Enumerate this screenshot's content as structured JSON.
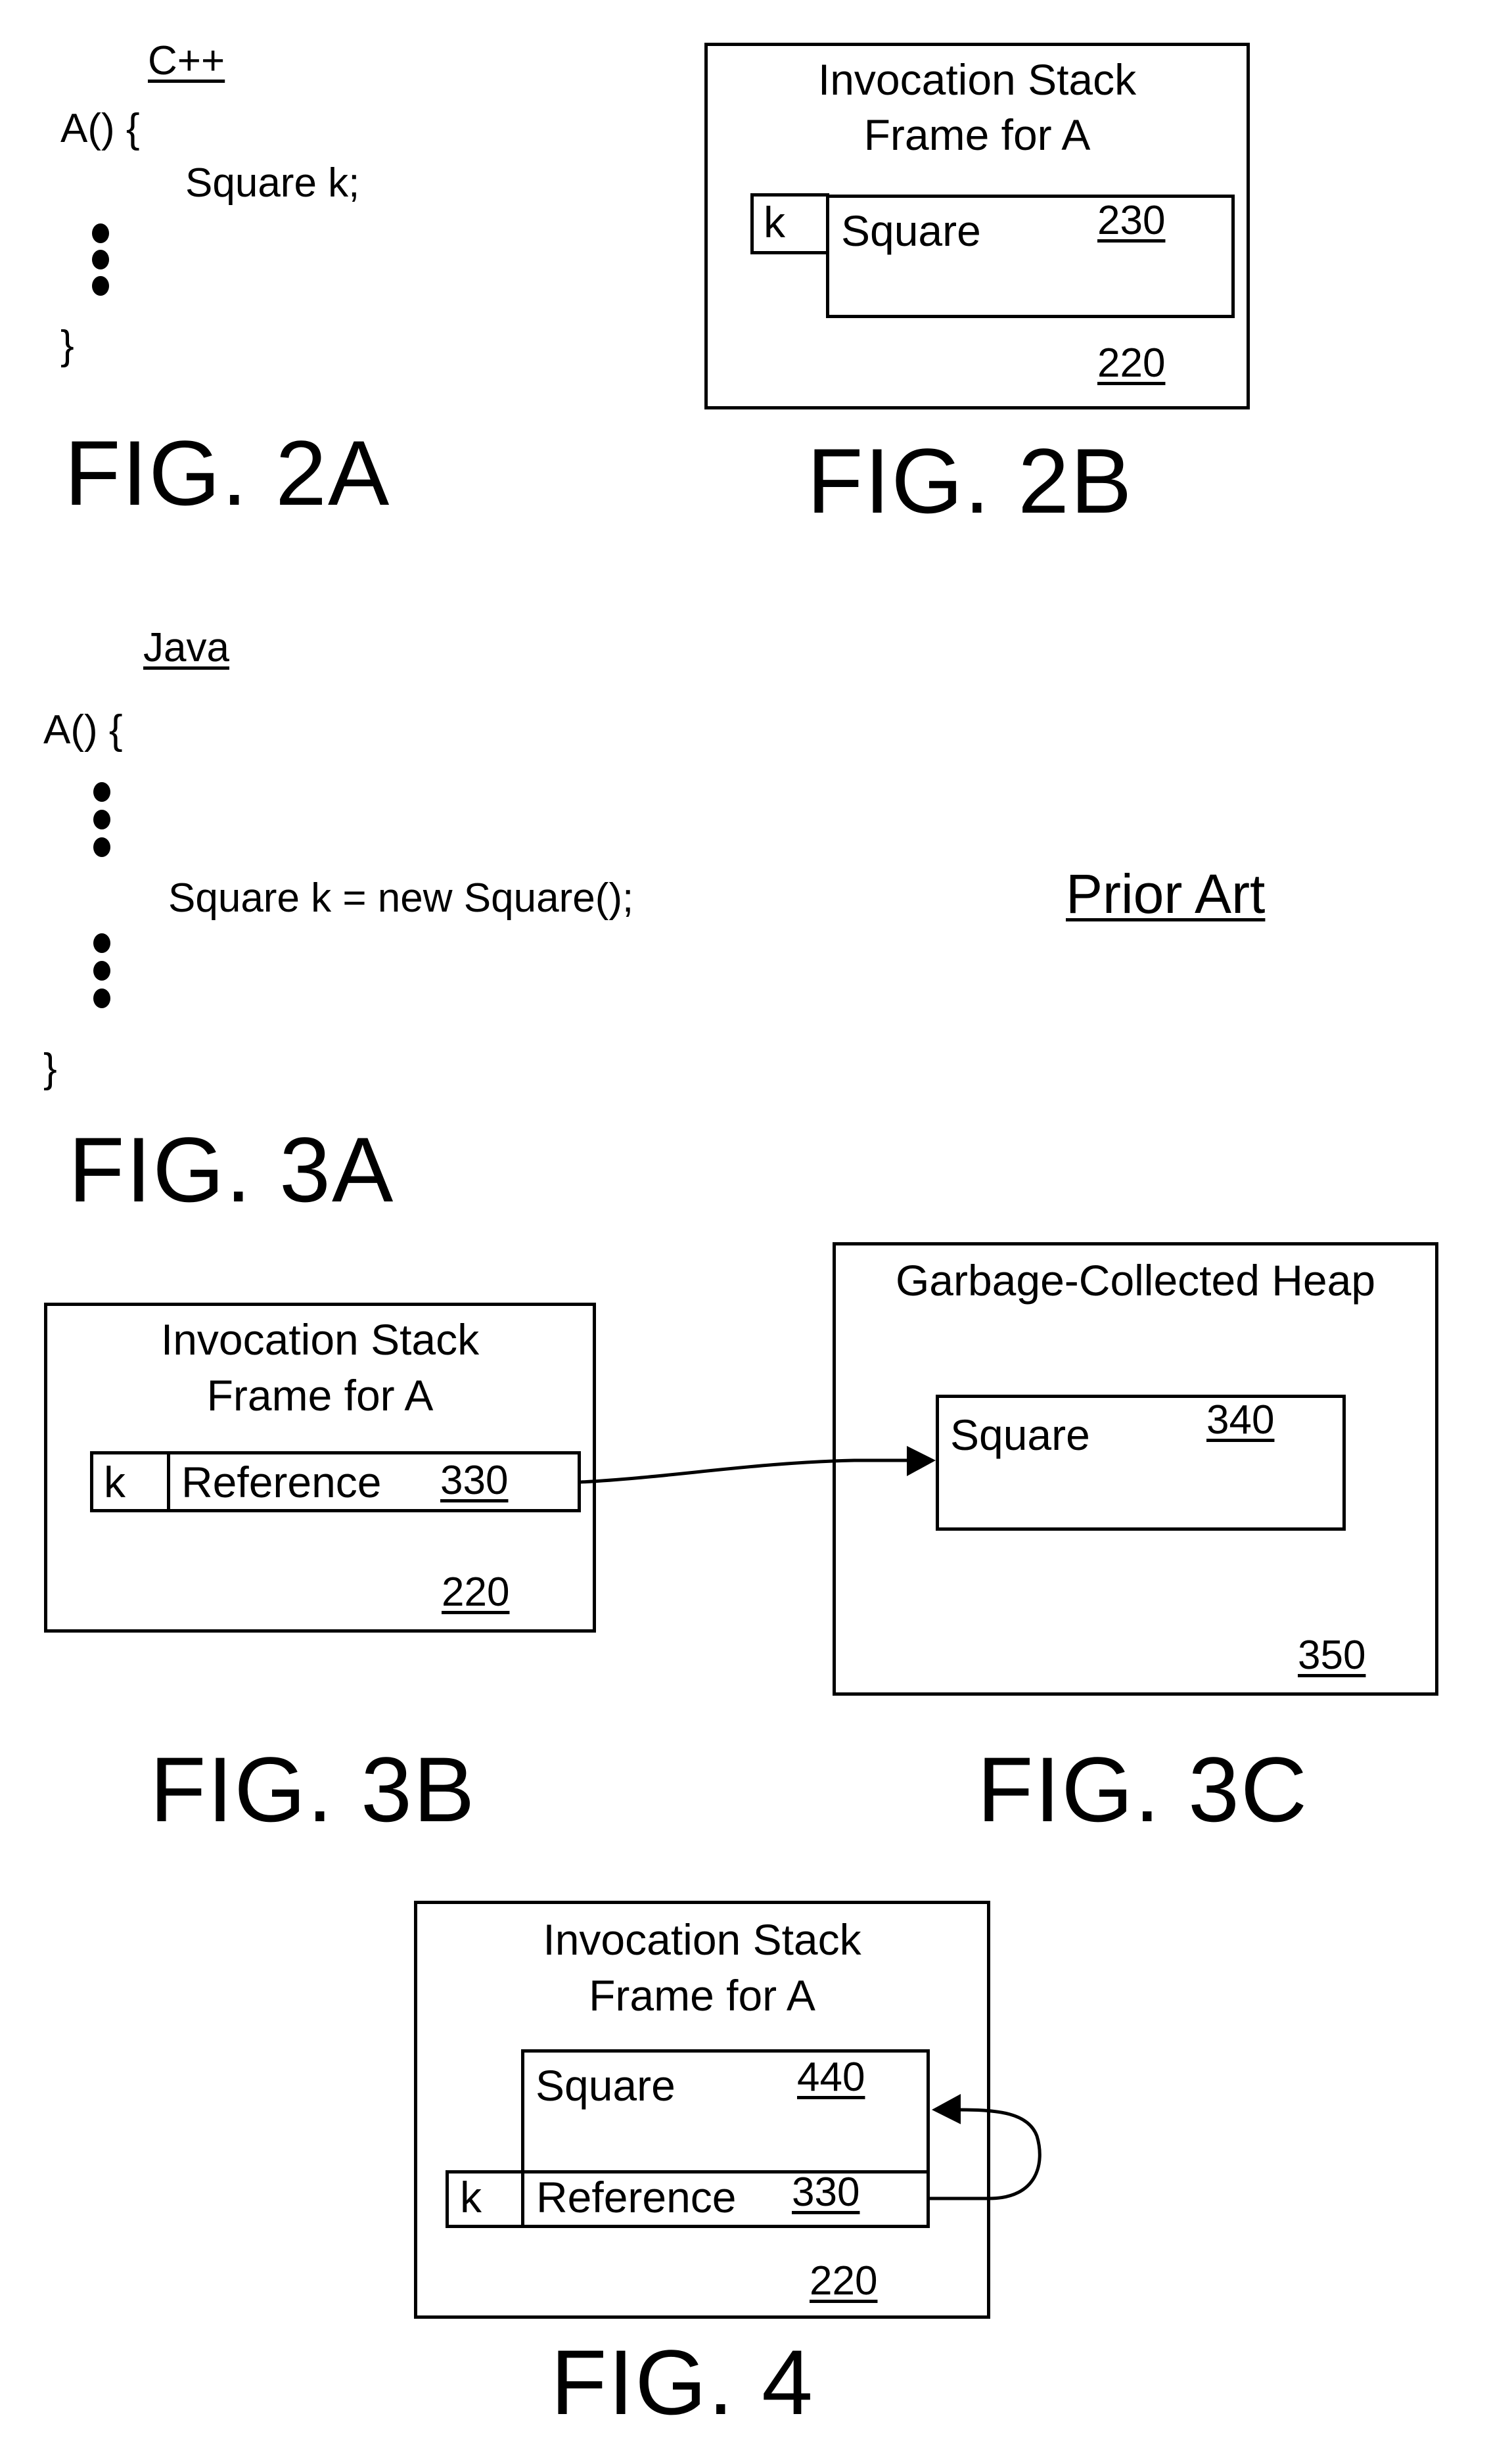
{
  "fig2a": {
    "language": "C++",
    "line_open": "A() {",
    "line_decl": "Square k;",
    "line_close": "}",
    "label": "FIG. 2A"
  },
  "fig2b": {
    "title_line1": "Invocation Stack",
    "title_line2": "Frame for A",
    "var_name": "k",
    "object_label": "Square",
    "object_ref": "230",
    "frame_ref": "220",
    "label": "FIG. 2B"
  },
  "fig3a": {
    "language": "Java",
    "line_open": "A() {",
    "line_decl": "Square k = new Square();",
    "line_close": "}",
    "label": "FIG. 3A"
  },
  "prior_art": "Prior Art",
  "fig3b": {
    "title_line1": "Invocation Stack",
    "title_line2": "Frame for A",
    "var_name": "k",
    "reference_label": "Reference",
    "reference_ref": "330",
    "frame_ref": "220",
    "label": "FIG. 3B"
  },
  "fig3c": {
    "title": "Garbage-Collected Heap",
    "object_label": "Square",
    "object_ref": "340",
    "heap_ref": "350",
    "label": "FIG. 3C"
  },
  "fig4": {
    "title_line1": "Invocation Stack",
    "title_line2": "Frame for A",
    "object_label": "Square",
    "object_ref": "440",
    "var_name": "k",
    "reference_label": "Reference",
    "reference_ref": "330",
    "frame_ref": "220",
    "label": "FIG. 4"
  }
}
